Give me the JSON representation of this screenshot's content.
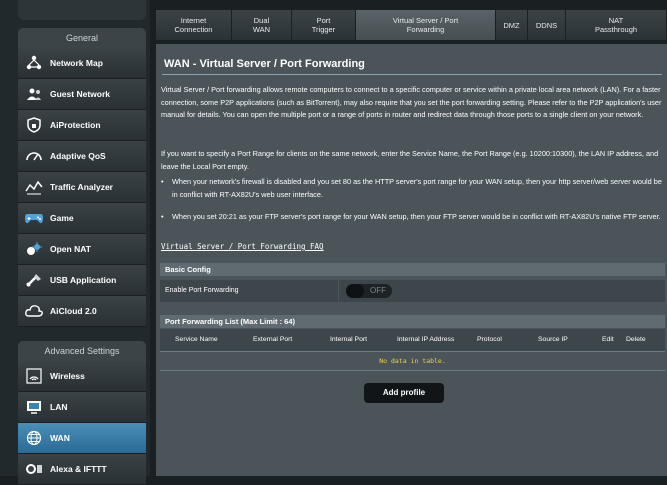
{
  "sidebar": {
    "general_header": "General",
    "items": [
      {
        "label": "Network Map",
        "icon": "network-map-icon"
      },
      {
        "label": "Guest Network",
        "icon": "guest-network-icon"
      },
      {
        "label": "AiProtection",
        "icon": "shield-icon"
      },
      {
        "label": "Adaptive QoS",
        "icon": "qos-gauge-icon"
      },
      {
        "label": "Traffic Analyzer",
        "icon": "traffic-analyzer-icon"
      },
      {
        "label": "Game",
        "icon": "gamepad-icon"
      },
      {
        "label": "Open NAT",
        "icon": "open-nat-icon"
      },
      {
        "label": "USB Application",
        "icon": "usb-icon"
      },
      {
        "label": "AiCloud 2.0",
        "icon": "cloud-icon"
      }
    ],
    "advanced_header": "Advanced Settings",
    "advanced_items": [
      {
        "label": "Wireless",
        "icon": "wireless-icon"
      },
      {
        "label": "LAN",
        "icon": "lan-icon"
      },
      {
        "label": "WAN",
        "icon": "wan-globe-icon",
        "active": true
      },
      {
        "label": "Alexa & IFTTT",
        "icon": "alexa-ifttt-icon"
      }
    ]
  },
  "tabs": [
    {
      "line1": "Internet",
      "line2": "Connection"
    },
    {
      "line1": "Dual",
      "line2": "WAN"
    },
    {
      "line1": "Port",
      "line2": "Trigger"
    },
    {
      "line1": "Virtual Server / Port",
      "line2": "Forwarding",
      "active": true
    },
    {
      "line1": "DMZ",
      "line2": ""
    },
    {
      "line1": "DDNS",
      "line2": ""
    },
    {
      "line1": "NAT",
      "line2": "Passthrough"
    }
  ],
  "main": {
    "title": "WAN - Virtual Server / Port Forwarding",
    "description_1": "Virtual Server / Port forwarding allows remote computers to connect to a specific computer or service within a private local area network (LAN). For a faster connection, some P2P applications (such as BitTorrent), may also require that you set the port forwarding setting. Please refer to the P2P application's user manual for details. You can open the multiple port or a range of ports in router and redirect data through those ports to a single client on your network.",
    "description_2": "If you want to specify a Port Range for clients on the same network, enter the Service Name, the Port Range (e.g. 10200:10300), the LAN IP address, and leave the Local Port empty.",
    "bullet_1": "When your network's firewall is disabled and you set 80 as the HTTP server's port range for your WAN setup, then your http server/web server would be in conflict with RT-AX82U's web user interface.",
    "bullet_2": "When you set 20:21 as your FTP server's port range for your WAN setup, then your FTP server would be in conflict with RT-AX82U's native FTP server.",
    "bullet_mark": "•",
    "faq_link": "Virtual Server / Port Forwarding FAQ"
  },
  "basic_config": {
    "header": "Basic Config",
    "enable_label": "Enable Port Forwarding",
    "toggle_state": "OFF"
  },
  "port_list": {
    "header": "Port Forwarding List (Max Limit : 64)",
    "columns": [
      "Service Name",
      "External Port",
      "Internal Port",
      "Internal IP Address",
      "Protocol",
      "Source IP",
      "Edit",
      "Delete"
    ],
    "empty_text": "No data in table."
  },
  "add_profile_label": "Add profile",
  "colors": {
    "accent": "#3a84b4",
    "panel": "#4b5459",
    "no_data_text": "#f0d34a"
  }
}
